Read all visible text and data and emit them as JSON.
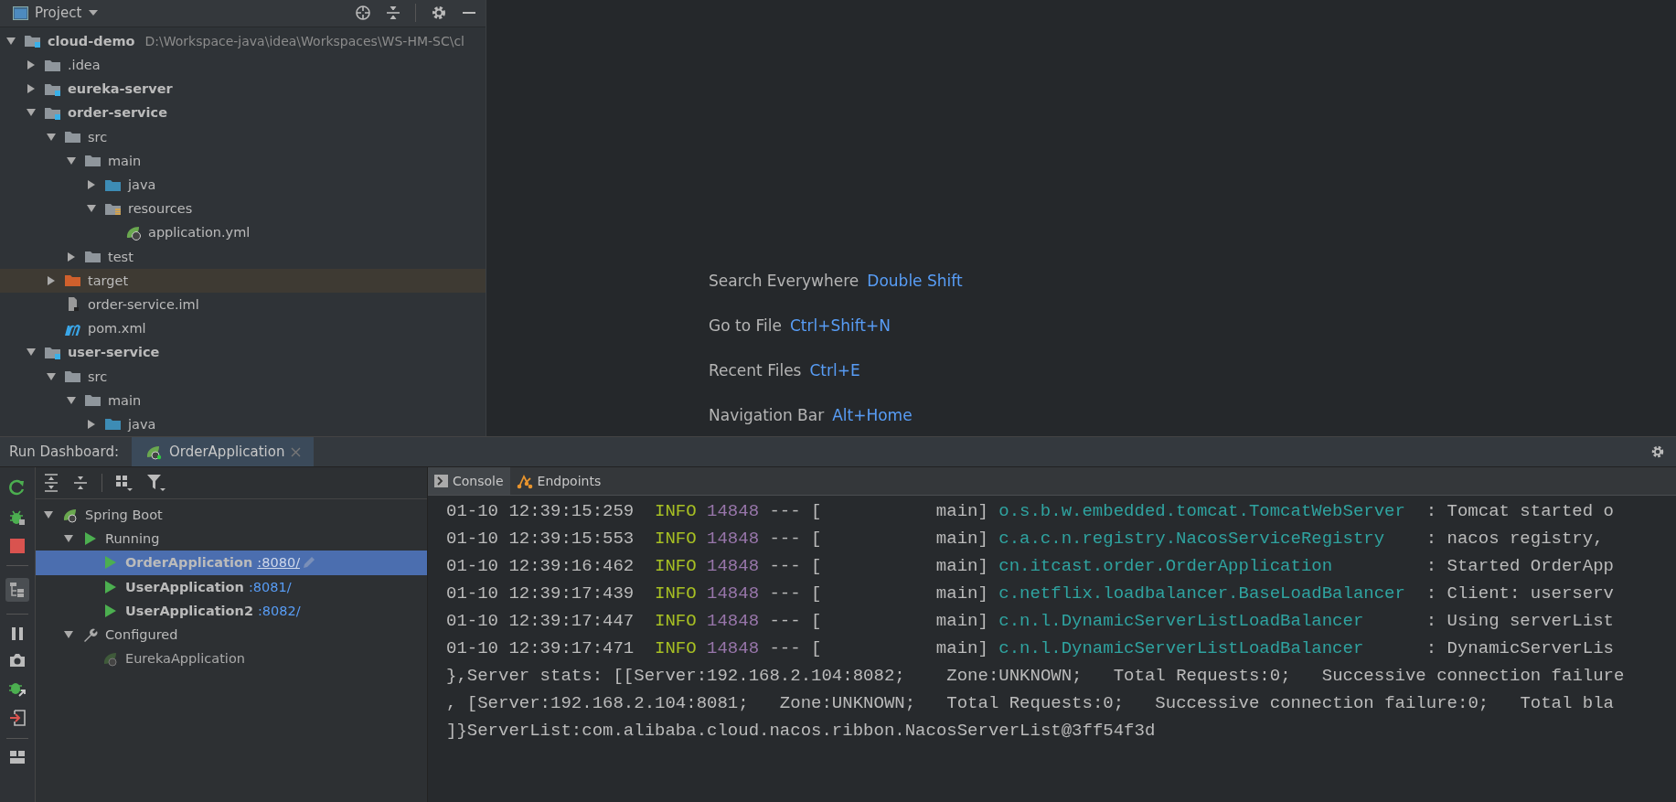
{
  "project_panel": {
    "title": "Project",
    "tree": [
      {
        "label": "cloud-demo",
        "path": "D:\\Workspace-java\\idea\\Workspaces\\WS-HM-SC\\cl",
        "kind": "module",
        "bold": true,
        "expanded": true,
        "children": [
          {
            "label": ".idea",
            "kind": "folder",
            "bold": false,
            "expanded": false
          },
          {
            "label": "eureka-server",
            "kind": "module",
            "bold": true,
            "expanded": false
          },
          {
            "label": "order-service",
            "kind": "module",
            "bold": true,
            "expanded": true,
            "children": [
              {
                "label": "src",
                "kind": "folder",
                "bold": false,
                "expanded": true,
                "children": [
                  {
                    "label": "main",
                    "kind": "folder",
                    "bold": false,
                    "expanded": true,
                    "children": [
                      {
                        "label": "java",
                        "kind": "source",
                        "bold": false,
                        "expanded": false
                      },
                      {
                        "label": "resources",
                        "kind": "resources",
                        "bold": false,
                        "expanded": true,
                        "children": [
                          {
                            "label": "application.yml",
                            "kind": "spring",
                            "bold": false
                          }
                        ]
                      }
                    ]
                  },
                  {
                    "label": "test",
                    "kind": "folder",
                    "bold": false,
                    "expanded": false
                  }
                ]
              },
              {
                "label": "target",
                "kind": "excluded",
                "bold": false,
                "expanded": false
              },
              {
                "label": "order-service.iml",
                "kind": "iml",
                "bold": false
              },
              {
                "label": "pom.xml",
                "kind": "maven",
                "bold": false
              }
            ]
          },
          {
            "label": "user-service",
            "kind": "module",
            "bold": true,
            "expanded": true,
            "children": [
              {
                "label": "src",
                "kind": "folder",
                "bold": false,
                "expanded": true,
                "children": [
                  {
                    "label": "main",
                    "kind": "folder",
                    "bold": false,
                    "expanded": true,
                    "children": [
                      {
                        "label": "java",
                        "kind": "source",
                        "bold": false,
                        "expanded": false
                      }
                    ]
                  }
                ]
              }
            ]
          }
        ]
      }
    ]
  },
  "editor_hints": [
    {
      "label": "Search Everywhere",
      "shortcut": "Double Shift"
    },
    {
      "label": "Go to File",
      "shortcut": "Ctrl+Shift+N"
    },
    {
      "label": "Recent Files",
      "shortcut": "Ctrl+E"
    },
    {
      "label": "Navigation Bar",
      "shortcut": "Alt+Home"
    }
  ],
  "run_dashboard": {
    "title": "Run Dashboard:",
    "tabs": [
      {
        "label": "OrderApplication",
        "selected": true
      }
    ],
    "tree": [
      {
        "label": "Spring Boot",
        "kind": "spring",
        "bold": false,
        "expanded": true,
        "selected": false,
        "children": [
          {
            "label": "Running",
            "kind": "run",
            "bold": false,
            "expanded": true,
            "selected": false,
            "children": [
              {
                "label": "OrderApplication",
                "port": ":8080/",
                "kind": "run",
                "bold": true,
                "selected": true
              },
              {
                "label": "UserApplication",
                "port": ":8081/",
                "kind": "run",
                "bold": true,
                "selected": false
              },
              {
                "label": "UserApplication2",
                "port": ":8082/",
                "kind": "run",
                "bold": true,
                "selected": false
              }
            ]
          },
          {
            "label": "Configured",
            "kind": "wrench",
            "bold": false,
            "expanded": true,
            "selected": false,
            "children": [
              {
                "label": "EurekaApplication",
                "kind": "spring-idle",
                "bold": false,
                "selected": false
              }
            ]
          }
        ]
      }
    ]
  },
  "console": {
    "tabs": [
      {
        "label": "Console",
        "kind": "console",
        "selected": true
      },
      {
        "label": "Endpoints",
        "kind": "endpoints",
        "selected": false
      }
    ],
    "lines": [
      {
        "kind": "log",
        "time": "01-10 12:39:15:259",
        "level": "INFO",
        "pid": "14848",
        "sep": "---",
        "thread": "[           main]",
        "logger": "o.s.b.w.embedded.tomcat.TomcatWebServer",
        "message": ": Tomcat started o"
      },
      {
        "kind": "log",
        "time": "01-10 12:39:15:553",
        "level": "INFO",
        "pid": "14848",
        "sep": "---",
        "thread": "[           main]",
        "logger": "c.a.c.n.registry.NacosServiceRegistry",
        "message": ": nacos registry,"
      },
      {
        "kind": "log",
        "time": "01-10 12:39:16:462",
        "level": "INFO",
        "pid": "14848",
        "sep": "---",
        "thread": "[           main]",
        "logger": "cn.itcast.order.OrderApplication",
        "message": ": Started OrderApp"
      },
      {
        "kind": "log",
        "time": "01-10 12:39:17:439",
        "level": "INFO",
        "pid": "14848",
        "sep": "---",
        "thread": "[           main]",
        "logger": "c.netflix.loadbalancer.BaseLoadBalancer",
        "message": ": Client: userserv"
      },
      {
        "kind": "log",
        "time": "01-10 12:39:17:447",
        "level": "INFO",
        "pid": "14848",
        "sep": "---",
        "thread": "[           main]",
        "logger": "c.n.l.DynamicServerListLoadBalancer",
        "message": ": Using serverList"
      },
      {
        "kind": "log",
        "time": "01-10 12:39:17:471",
        "level": "INFO",
        "pid": "14848",
        "sep": "---",
        "thread": "[           main]",
        "logger": "c.n.l.DynamicServerListLoadBalancer",
        "message": ": DynamicServerLis"
      },
      {
        "kind": "plain",
        "text": "},Server stats: [[Server:192.168.2.104:8082;    Zone:UNKNOWN;   Total Requests:0;   Successive connection failure"
      },
      {
        "kind": "plain",
        "text": ", [Server:192.168.2.104:8081;   Zone:UNKNOWN;   Total Requests:0;   Successive connection failure:0;   Total bla"
      },
      {
        "kind": "plain",
        "text": "]}ServerList:com.alibaba.cloud.nacos.ribbon.NacosServerList@3ff54f3d"
      }
    ]
  }
}
